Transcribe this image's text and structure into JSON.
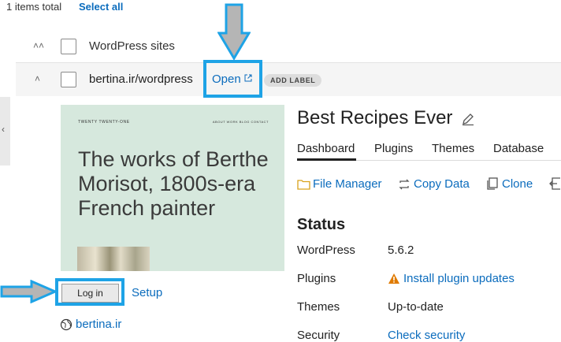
{
  "header": {
    "items_total": "1 items total",
    "select_all": "Select all"
  },
  "group_row": {
    "label": "WordPress sites"
  },
  "site_row": {
    "url": "bertina.ir/wordpress",
    "open": "Open",
    "add_label": "ADD LABEL"
  },
  "thumbnail": {
    "brand": "TWENTY TWENTY-ONE",
    "nav": "ABOUT   WORK   BLOG   CONTACT",
    "heading": "The works of Berthe Morisot, 1800s-era French painter"
  },
  "actions": {
    "login": "Log in",
    "setup": "Setup",
    "domain": "bertina.ir"
  },
  "panel": {
    "title": "Best Recipes Ever",
    "tabs": [
      "Dashboard",
      "Plugins",
      "Themes",
      "Database"
    ],
    "tools": {
      "file_manager": "File Manager",
      "copy_data": "Copy Data",
      "clone": "Clone"
    },
    "status_heading": "Status",
    "status": [
      {
        "label": "WordPress",
        "value": "5.6.2"
      },
      {
        "label": "Plugins",
        "value": "Install plugin updates"
      },
      {
        "label": "Themes",
        "value": "Up-to-date"
      },
      {
        "label": "Security",
        "value": "Check security"
      }
    ]
  },
  "colors": {
    "link": "#0b6cbd",
    "highlight": "#1ea3e6",
    "warning": "#e07b00",
    "thumbnail_bg": "#d6e8dd"
  }
}
